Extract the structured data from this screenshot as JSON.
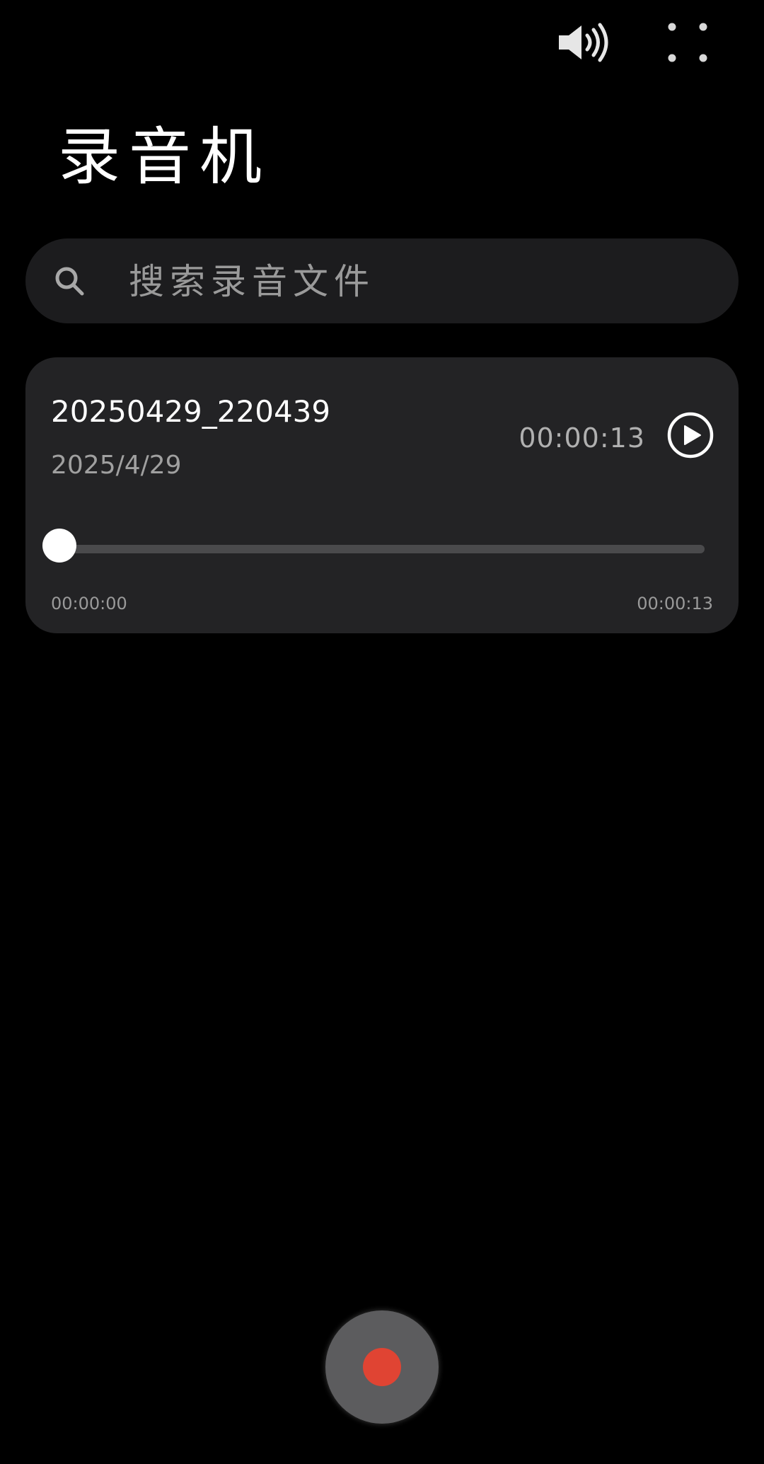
{
  "header": {
    "speaker_icon": "speaker-volume-icon",
    "more_icon": "more-dots-icon"
  },
  "page": {
    "title": "录音机"
  },
  "search": {
    "placeholder": "搜索录音文件",
    "icon": "search-icon"
  },
  "recordings": [
    {
      "name": "20250429_220439",
      "date": "2025/4/29",
      "duration": "00:00:13",
      "current_time": "00:00:00",
      "total_time": "00:00:13",
      "progress": 0.0
    }
  ],
  "record_button": {
    "accent": "#e04433"
  },
  "colors": {
    "background": "#000000",
    "card": "#232325",
    "search_bg": "#1c1c1e"
  }
}
